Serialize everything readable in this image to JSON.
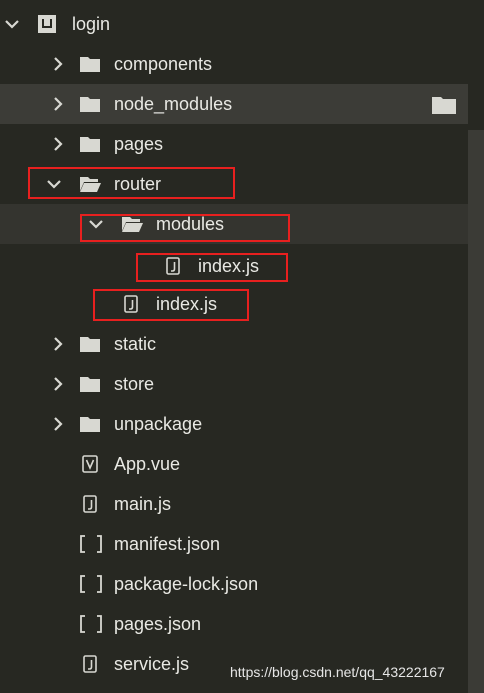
{
  "root": {
    "label": "login"
  },
  "items": [
    {
      "label": "components"
    },
    {
      "label": "node_modules"
    },
    {
      "label": "pages"
    },
    {
      "label": "router"
    },
    {
      "label": "modules"
    },
    {
      "label": "index.js"
    },
    {
      "label": "index.js"
    },
    {
      "label": "static"
    },
    {
      "label": "store"
    },
    {
      "label": "unpackage"
    },
    {
      "label": "App.vue"
    },
    {
      "label": "main.js"
    },
    {
      "label": "manifest.json"
    },
    {
      "label": "package-lock.json"
    },
    {
      "label": "pages.json"
    },
    {
      "label": "service.js"
    }
  ],
  "watermark": "https://blog.csdn.net/qq_43222167",
  "colors": {
    "background": "#272822",
    "highlight": "#3c3c37",
    "annotation": "#e8201f",
    "text": "#e9e9e4",
    "icon": "#d8d8d2"
  },
  "icons": {
    "chevron_right": "chevron-right-icon",
    "chevron_down": "chevron-down-icon",
    "folder": "folder-icon",
    "folder_open": "folder-open-icon",
    "file_js": "js-file-icon",
    "file_vue": "vue-file-icon",
    "file_json": "json-file-icon",
    "project": "project-icon"
  }
}
